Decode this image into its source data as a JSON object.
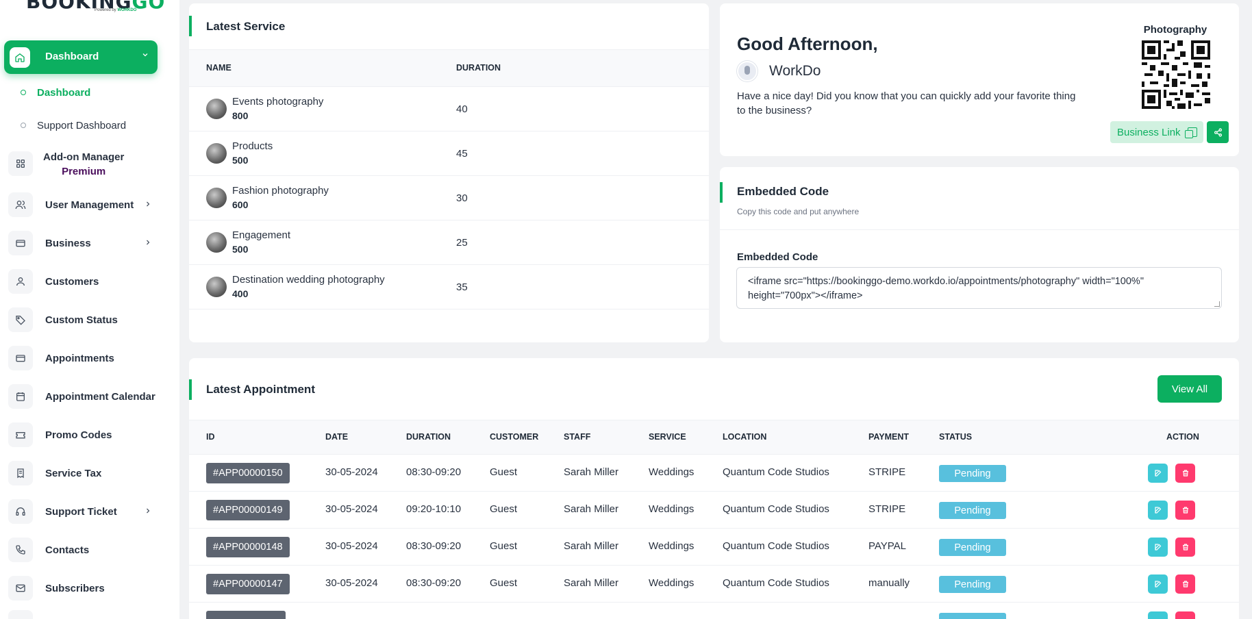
{
  "brand": {
    "logo_main": "BOOKING",
    "logo_accent": "GO",
    "logo_sub_prefix": "Powered by",
    "logo_sub_brand": "WORKDO"
  },
  "sidebar": {
    "dashboard_label": "Dashboard",
    "sub_items": [
      {
        "label": "Dashboard"
      },
      {
        "label": "Support Dashboard"
      }
    ],
    "addon_label": "Add-on Manager",
    "addon_badge": "Premium",
    "items": [
      {
        "label": "User Management"
      },
      {
        "label": "Business"
      },
      {
        "label": "Customers"
      },
      {
        "label": "Custom Status"
      },
      {
        "label": "Appointments"
      },
      {
        "label": "Appointment Calendar"
      },
      {
        "label": "Promo Codes"
      },
      {
        "label": "Service Tax"
      },
      {
        "label": "Support Ticket"
      },
      {
        "label": "Contacts"
      },
      {
        "label": "Subscribers"
      }
    ]
  },
  "latest_service": {
    "title": "Latest Service",
    "columns": [
      "NAME",
      "DURATION"
    ],
    "rows": [
      {
        "name": "Events photography",
        "price": "800",
        "duration": "40"
      },
      {
        "name": "Products",
        "price": "500",
        "duration": "45"
      },
      {
        "name": "Fashion photography",
        "price": "600",
        "duration": "30"
      },
      {
        "name": "Engagement",
        "price": "500",
        "duration": "25"
      },
      {
        "name": "Destination wedding photography",
        "price": "400",
        "duration": "35"
      }
    ]
  },
  "greeting": {
    "title": "Good Afternoon,",
    "user": "WorkDo",
    "message": "Have a nice day! Did you know that you can quickly add your favorite thing to the business?",
    "qr_title": "Photography",
    "business_link": "Business Link"
  },
  "embedded": {
    "title": "Embedded Code",
    "subtitle": "Copy this code and put anywhere",
    "label": "Embedded Code",
    "code": "<iframe src=\"https://bookinggo-demo.workdo.io/appointments/photography\" width=\"100%\" height=\"700px\"></iframe>"
  },
  "appointments": {
    "title": "Latest Appointment",
    "view_all": "View All",
    "columns": [
      "ID",
      "DATE",
      "DURATION",
      "CUSTOMER",
      "STAFF",
      "SERVICE",
      "LOCATION",
      "PAYMENT",
      "STATUS",
      "ACTION"
    ],
    "rows": [
      {
        "id": "#APP00000150",
        "date": "30-05-2024",
        "duration": "08:30-09:20",
        "customer": "Guest",
        "staff": "Sarah Miller",
        "service": "Weddings",
        "location": "Quantum Code Studios",
        "payment": "STRIPE",
        "status": "Pending"
      },
      {
        "id": "#APP00000149",
        "date": "30-05-2024",
        "duration": "09:20-10:10",
        "customer": "Guest",
        "staff": "Sarah Miller",
        "service": "Weddings",
        "location": "Quantum Code Studios",
        "payment": "STRIPE",
        "status": "Pending"
      },
      {
        "id": "#APP00000148",
        "date": "30-05-2024",
        "duration": "08:30-09:20",
        "customer": "Guest",
        "staff": "Sarah Miller",
        "service": "Weddings",
        "location": "Quantum Code Studios",
        "payment": "PAYPAL",
        "status": "Pending"
      },
      {
        "id": "#APP00000147",
        "date": "30-05-2024",
        "duration": "08:30-09:20",
        "customer": "Guest",
        "staff": "Sarah Miller",
        "service": "Weddings",
        "location": "Quantum Code Studios",
        "payment": "manually",
        "status": "Pending"
      }
    ]
  },
  "colors": {
    "accent": "#0caf60",
    "status_pending": "#58c0dd",
    "edit": "#3ec9d6",
    "delete": "#ff3a6e"
  }
}
